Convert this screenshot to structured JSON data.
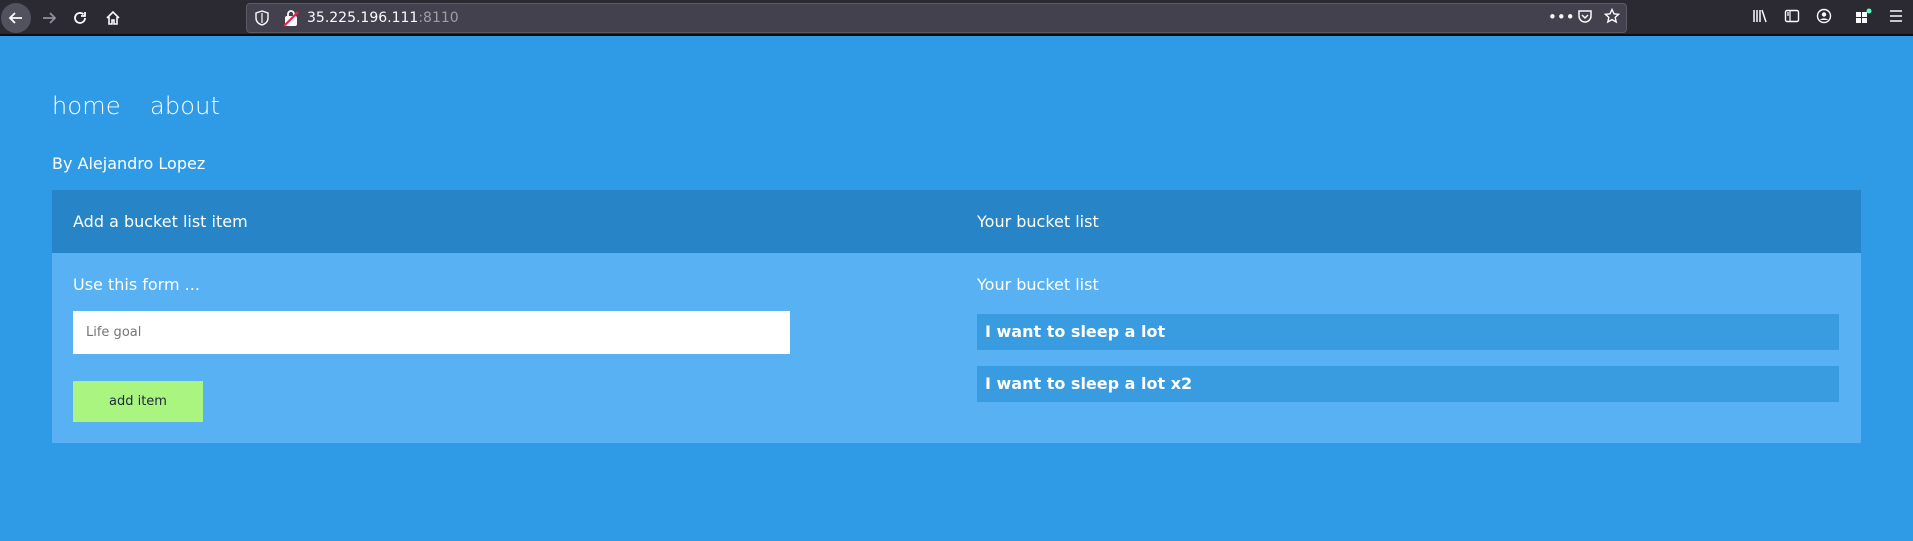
{
  "browser": {
    "url_host": "35.225.196.111",
    "url_port": ":8110",
    "icons": [
      "back-arrow-icon",
      "forward-arrow-icon",
      "reload-icon",
      "home-icon",
      "shield-icon",
      "insecure-lock-icon",
      "more-dots-icon",
      "pocket-icon",
      "bookmark-star-icon",
      "library-icon",
      "sidebar-icon",
      "account-icon",
      "extensions-icon",
      "menu-icon"
    ]
  },
  "nav": {
    "links": [
      {
        "label": "home"
      },
      {
        "label": "about"
      }
    ]
  },
  "byline": "By Alejandro Lopez",
  "panel": {
    "left_header": "Add a bucket list item",
    "right_header": "Your bucket list",
    "form_title": "Use this form ...",
    "input": {
      "placeholder": "Life goal",
      "value": ""
    },
    "add_button": "add item",
    "list_title": "Your bucket list",
    "items": [
      {
        "text": "I want to sleep a lot"
      },
      {
        "text": "I want to sleep a lot x2"
      }
    ]
  },
  "colors": {
    "page_bg": "#2f9be6",
    "panel_bg": "#57b1f2",
    "panel_header_bg": "#2784c6",
    "item_bg": "#3a9ce0",
    "button_bg": "#aaf480"
  }
}
